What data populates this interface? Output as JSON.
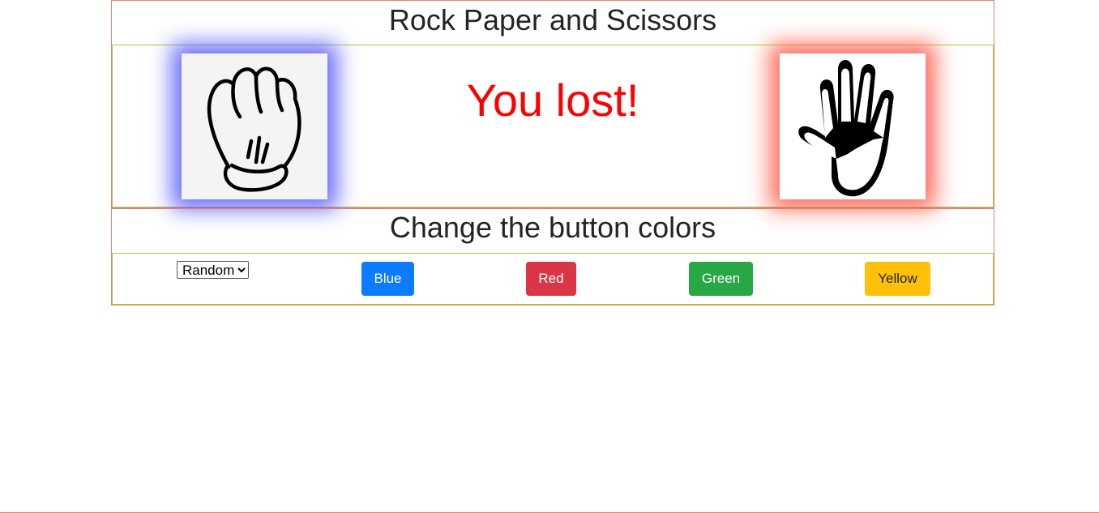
{
  "game": {
    "title": "Rock Paper and Scissors",
    "result": "You lost!",
    "player_choice": "rock-hand-icon",
    "computer_choice": "paper-hand-icon",
    "player_glow_color": "#5050ff",
    "computer_glow_color": "#ff503c",
    "result_color": "#ff0000"
  },
  "colors": {
    "title": "Change the button colors",
    "select": {
      "selected": "Random",
      "options": [
        "Random"
      ]
    },
    "buttons": {
      "blue": "Blue",
      "red": "Red",
      "green": "Green",
      "yellow": "Yellow"
    },
    "button_colors": {
      "blue": "#0d7bfe",
      "red": "#dc3545",
      "green": "#28a745",
      "yellow": "#ffc107"
    }
  }
}
